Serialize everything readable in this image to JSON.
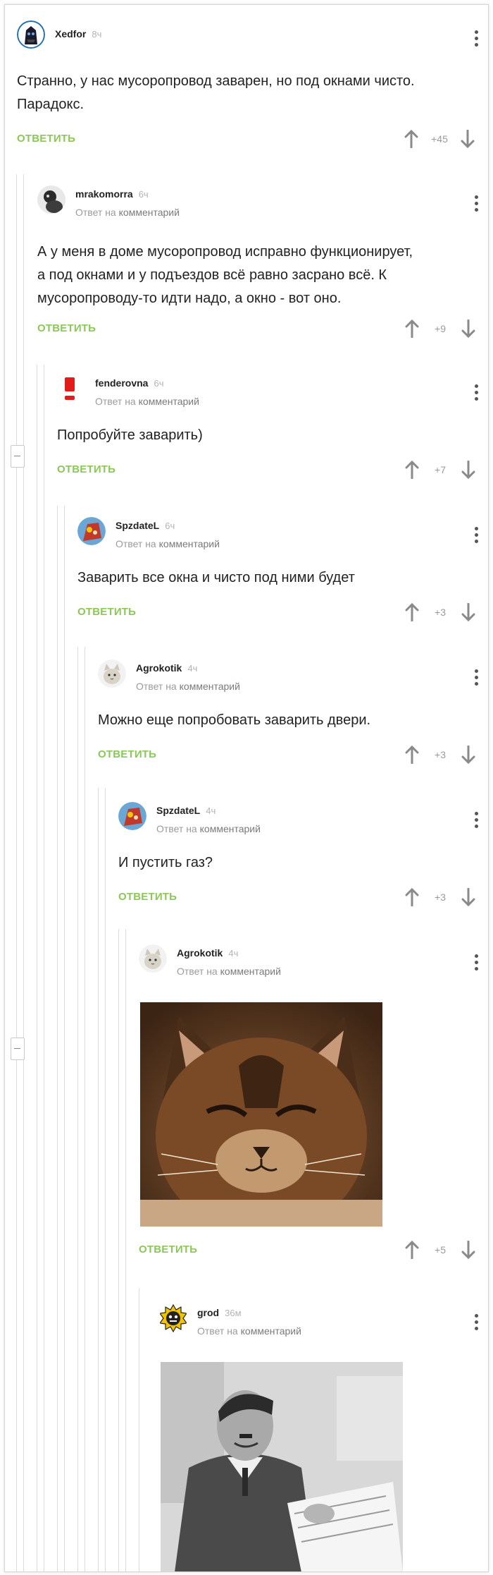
{
  "reply_label": "ОТВЕТИТЬ",
  "reply_to_prefix": "Ответ на",
  "reply_to_target": "комментарий",
  "comments": [
    {
      "username": "Xedfor",
      "time": "8ч",
      "text_lines": [
        "Странно, у нас мусоропровод заварен, но под окнами чисто.",
        "Парадокс."
      ],
      "votes": "+45"
    },
    {
      "username": "mrakomorra",
      "time": "6ч",
      "text_lines": [
        "А у меня в доме мусоропровод исправно функционирует,",
        "а под окнами и у подъездов всё равно засрано всё. К",
        "мусоропроводу-то идти надо, а окно - вот оно."
      ],
      "votes": "+9"
    },
    {
      "username": "fenderovna",
      "time": "6ч",
      "text_lines": [
        "Попробуйте заварить)"
      ],
      "votes": "+7"
    },
    {
      "username": "SpzdateL",
      "time": "6ч",
      "text_lines": [
        "Заварить все окна и чисто под ними будет"
      ],
      "votes": "+3"
    },
    {
      "username": "Agrokotik",
      "time": "4ч",
      "text_lines": [
        "Можно еще попробовать заварить двери."
      ],
      "votes": "+3"
    },
    {
      "username": "SpzdateL",
      "time": "4ч",
      "text_lines": [
        "И пустить газ?"
      ],
      "votes": "+3"
    },
    {
      "username": "Agrokotik",
      "time": "4ч",
      "text_lines": [],
      "votes": "+5"
    },
    {
      "username": "grod",
      "time": "36м",
      "text_lines": [],
      "votes": ""
    }
  ],
  "colors": {
    "reply": "#8ac858",
    "vote_arrow": "#8a8a8a",
    "thread_line": "#dcdcdc"
  }
}
